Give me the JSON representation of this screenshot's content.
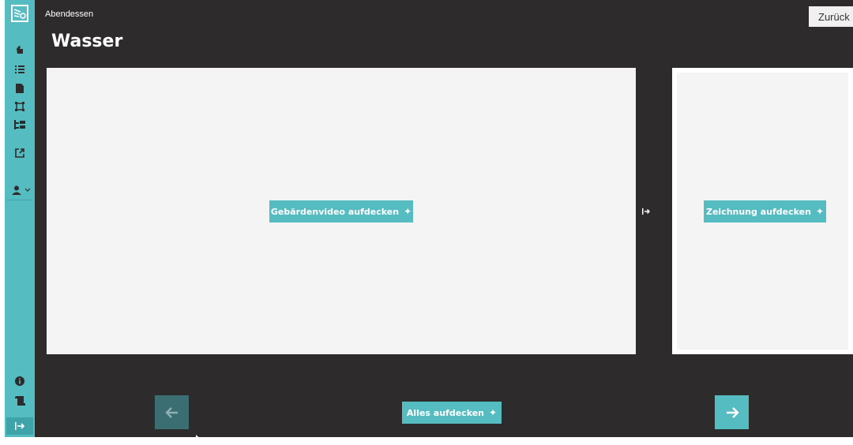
{
  "header": {
    "breadcrumb": "Abendessen",
    "back_label": "Zurück"
  },
  "page": {
    "title": "Wasser"
  },
  "cards": {
    "video_reveal_label": "Gebärdenvideo aufdecken",
    "drawing_reveal_label": "Zeichnung aufdecken"
  },
  "footer": {
    "reveal_all_label": "Alles aufdecken"
  },
  "sidebar": {
    "icons": [
      "logo-icon",
      "hand-icon",
      "list-icon",
      "document-icon",
      "frame-icon",
      "hierarchy-icon",
      "external-link-icon",
      "user-icon",
      "chevron-down-icon",
      "info-icon",
      "scroll-icon",
      "collapse-icon"
    ]
  },
  "colors": {
    "accent": "#55bcc2",
    "accent_dark": "#3fa4aa",
    "background": "#2d2b2b",
    "card": "#f4f4f4",
    "prev_disabled": "#3a6e72"
  }
}
